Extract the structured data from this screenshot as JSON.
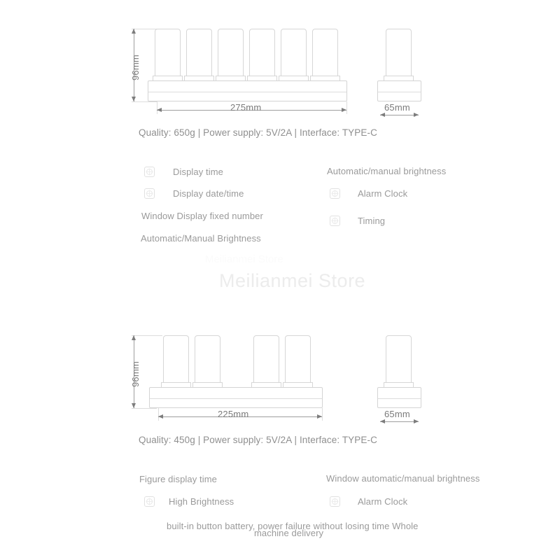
{
  "products": [
    {
      "id": "six-tube",
      "front_view": {
        "height_label": "96mm",
        "width_label": "275mm",
        "tube_count": 6
      },
      "side_view": {
        "width_label": "65mm"
      },
      "spec_line": "Quality: 650g | Power supply: 5V/2A | Interface: TYPE-C",
      "features_left": [
        {
          "label": "Display time",
          "icon": "image-placeholder-icon",
          "has_icon": true
        },
        {
          "label": "Display date/time",
          "icon": "image-placeholder-icon",
          "has_icon": true
        },
        {
          "label": "Window Display fixed number",
          "icon": "",
          "has_icon": false
        },
        {
          "label": "Automatic/Manual Brightness",
          "icon": "",
          "has_icon": false
        }
      ],
      "features_right": [
        {
          "label": "Automatic/manual brightness",
          "icon": "",
          "has_icon": false
        },
        {
          "label": "Alarm Clock",
          "icon": "image-placeholder-icon",
          "has_icon": true
        },
        {
          "label": "Timing",
          "icon": "image-placeholder-icon",
          "has_icon": true
        }
      ]
    },
    {
      "id": "four-tube",
      "front_view": {
        "height_label": "96mm",
        "width_label": "225mm",
        "tube_count": 4
      },
      "side_view": {
        "width_label": "65mm"
      },
      "spec_line": "Quality: 450g | Power supply: 5V/2A | Interface: TYPE-C",
      "features_left": [
        {
          "label": "Figure display time",
          "icon": "",
          "has_icon": false
        },
        {
          "label": "High Brightness",
          "icon": "image-placeholder-icon",
          "has_icon": true
        }
      ],
      "features_right": [
        {
          "label": "Window automatic/manual brightness",
          "icon": "",
          "has_icon": false
        },
        {
          "label": "Alarm Clock",
          "icon": "image-placeholder-icon",
          "has_icon": true
        }
      ],
      "footer_note_line1": "built-in button battery, power failure without losing time Whole",
      "footer_note_line2": "machine delivery"
    }
  ],
  "watermark": {
    "main": "Meilianmei Store",
    "faint": "Meilianmei Store"
  },
  "colors": {
    "line": "#d6d6d6",
    "dimension": "#9e9e9e",
    "text": "#8f8f8f",
    "watermark": "#ececec",
    "background": "#ffffff"
  }
}
